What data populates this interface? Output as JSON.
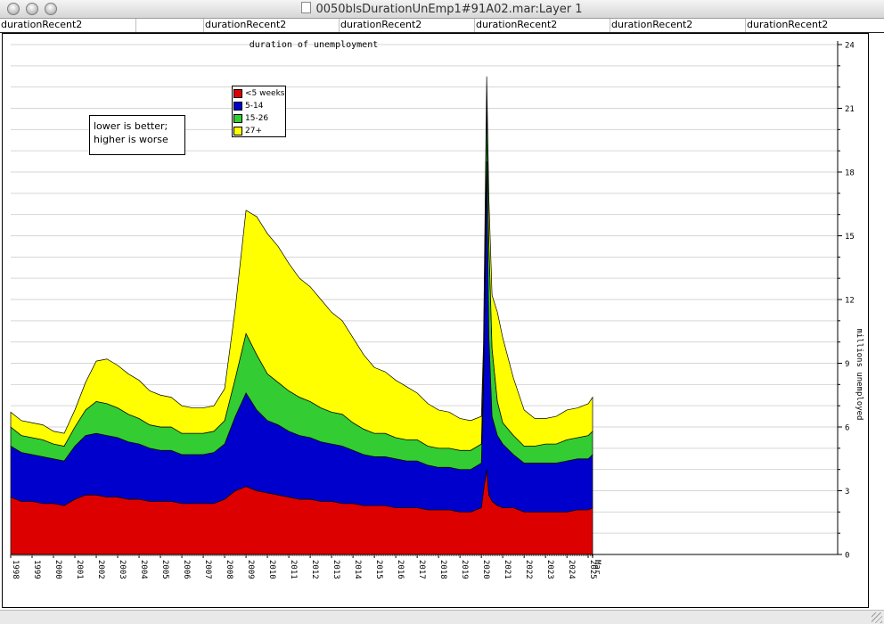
{
  "window": {
    "title": "0050blsDurationUnEmp1#91A02.mar:Layer 1"
  },
  "column_headers": [
    "durationRecent2",
    "",
    "durationRecent2",
    "durationRecent2",
    "durationRecent2",
    "durationRecent2",
    "durationRecent2"
  ],
  "note": {
    "line1": "lower is better;",
    "line2": "higher is worse"
  },
  "chart_data": {
    "type": "area",
    "stacked": true,
    "title": "duration of unemployment",
    "ylabel": "millions unemployed",
    "y_axis_position": "right",
    "ylim": [
      0,
      24
    ],
    "y_ticks": [
      0,
      3,
      6,
      9,
      12,
      15,
      18,
      21,
      24
    ],
    "xlim": [
      1998,
      2025.5
    ],
    "x_tick_labels": [
      "1998",
      "1999",
      "2000",
      "2001",
      "2002",
      "2003",
      "2004",
      "2005",
      "2006",
      "2007",
      "2008",
      "2009",
      "2010",
      "2011",
      "2012",
      "2013",
      "2014",
      "2015",
      "2016",
      "2017",
      "2018",
      "2019",
      "2020",
      "2021",
      "2022",
      "2023",
      "2024",
      "2025",
      "Mar"
    ],
    "grid": true,
    "legend_position": "top-left",
    "x": [
      1998.0,
      1998.5,
      1999.0,
      1999.5,
      2000.0,
      2000.5,
      2001.0,
      2001.5,
      2002.0,
      2002.5,
      2003.0,
      2003.5,
      2004.0,
      2004.5,
      2005.0,
      2005.5,
      2006.0,
      2006.5,
      2007.0,
      2007.5,
      2008.0,
      2008.5,
      2009.0,
      2009.5,
      2010.0,
      2010.5,
      2011.0,
      2011.5,
      2012.0,
      2012.5,
      2013.0,
      2013.5,
      2014.0,
      2014.5,
      2015.0,
      2015.5,
      2016.0,
      2016.5,
      2017.0,
      2017.5,
      2018.0,
      2018.5,
      2019.0,
      2019.5,
      2020.0,
      2020.1,
      2020.25,
      2020.35,
      2020.5,
      2020.75,
      2021.0,
      2021.5,
      2022.0,
      2022.5,
      2023.0,
      2023.5,
      2024.0,
      2024.5,
      2025.0,
      2025.2
    ],
    "series": [
      {
        "name": "<5 weeks",
        "color": "#dd0000",
        "values": [
          2.7,
          2.5,
          2.5,
          2.4,
          2.4,
          2.3,
          2.6,
          2.8,
          2.8,
          2.7,
          2.7,
          2.6,
          2.6,
          2.5,
          2.5,
          2.5,
          2.4,
          2.4,
          2.4,
          2.4,
          2.6,
          3.0,
          3.2,
          3.0,
          2.9,
          2.8,
          2.7,
          2.6,
          2.6,
          2.5,
          2.5,
          2.4,
          2.4,
          2.3,
          2.3,
          2.3,
          2.2,
          2.2,
          2.2,
          2.1,
          2.1,
          2.1,
          2.0,
          2.0,
          2.2,
          3.0,
          4.0,
          2.8,
          2.5,
          2.3,
          2.2,
          2.2,
          2.0,
          2.0,
          2.0,
          2.0,
          2.0,
          2.1,
          2.1,
          2.2
        ]
      },
      {
        "name": "5-14",
        "color": "#0000cc",
        "values": [
          2.4,
          2.3,
          2.2,
          2.2,
          2.1,
          2.1,
          2.5,
          2.8,
          2.9,
          2.9,
          2.8,
          2.7,
          2.6,
          2.5,
          2.4,
          2.4,
          2.3,
          2.3,
          2.3,
          2.4,
          2.6,
          3.5,
          4.4,
          3.8,
          3.4,
          3.3,
          3.1,
          3.0,
          2.9,
          2.8,
          2.7,
          2.7,
          2.5,
          2.4,
          2.3,
          2.3,
          2.3,
          2.2,
          2.2,
          2.1,
          2.0,
          2.0,
          2.0,
          2.0,
          2.1,
          5.0,
          14.5,
          7.5,
          4.0,
          3.3,
          3.0,
          2.5,
          2.3,
          2.3,
          2.3,
          2.3,
          2.4,
          2.4,
          2.4,
          2.5
        ]
      },
      {
        "name": "15-26",
        "color": "#33cc33",
        "values": [
          0.9,
          0.8,
          0.8,
          0.8,
          0.7,
          0.7,
          0.9,
          1.2,
          1.5,
          1.5,
          1.4,
          1.3,
          1.2,
          1.1,
          1.1,
          1.1,
          1.0,
          1.0,
          1.0,
          1.0,
          1.1,
          1.8,
          2.8,
          2.6,
          2.2,
          2.0,
          1.9,
          1.8,
          1.7,
          1.6,
          1.5,
          1.5,
          1.3,
          1.2,
          1.1,
          1.1,
          1.0,
          1.0,
          1.0,
          0.9,
          0.9,
          0.9,
          0.9,
          0.9,
          0.9,
          0.9,
          3.0,
          4.5,
          3.2,
          1.6,
          1.0,
          0.9,
          0.8,
          0.8,
          0.9,
          0.9,
          1.0,
          1.0,
          1.1,
          1.1
        ]
      },
      {
        "name": "27+",
        "color": "#ffff00",
        "values": [
          0.7,
          0.7,
          0.7,
          0.7,
          0.6,
          0.6,
          0.8,
          1.3,
          1.9,
          2.1,
          2.0,
          1.9,
          1.8,
          1.6,
          1.5,
          1.4,
          1.3,
          1.2,
          1.2,
          1.2,
          1.5,
          3.3,
          5.8,
          6.5,
          6.6,
          6.4,
          6.0,
          5.6,
          5.4,
          5.1,
          4.7,
          4.4,
          4.0,
          3.5,
          3.1,
          2.9,
          2.7,
          2.5,
          2.2,
          2.0,
          1.8,
          1.7,
          1.5,
          1.4,
          1.3,
          1.0,
          1.0,
          2.0,
          2.5,
          4.2,
          4.0,
          2.7,
          1.7,
          1.3,
          1.2,
          1.3,
          1.4,
          1.4,
          1.5,
          1.6
        ]
      }
    ]
  }
}
